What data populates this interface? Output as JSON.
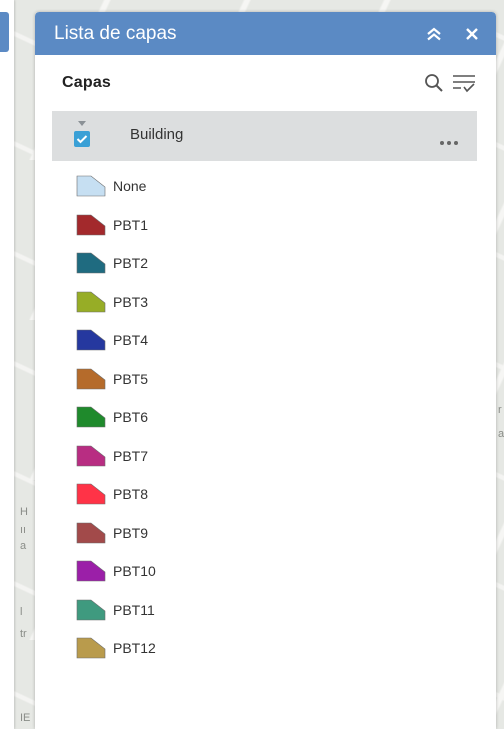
{
  "panel": {
    "title": "Lista de capas",
    "toolbar_title": "Capas"
  },
  "layer": {
    "name": "Building",
    "checked": true
  },
  "legend": [
    {
      "label": "None",
      "color": "#c6dff2"
    },
    {
      "label": "PBT1",
      "color": "#a3292c"
    },
    {
      "label": "PBT2",
      "color": "#1f6b80"
    },
    {
      "label": "PBT3",
      "color": "#97ad26"
    },
    {
      "label": "PBT4",
      "color": "#25389f"
    },
    {
      "label": "PBT5",
      "color": "#b56b2b"
    },
    {
      "label": "PBT6",
      "color": "#1f8a2c"
    },
    {
      "label": "PBT7",
      "color": "#b82d82"
    },
    {
      "label": "PBT8",
      "color": "#ff3347"
    },
    {
      "label": "PBT9",
      "color": "#a24a4a"
    },
    {
      "label": "PBT10",
      "color": "#9b1fa8"
    },
    {
      "label": "PBT11",
      "color": "#3f9a7f"
    },
    {
      "label": "PBT12",
      "color": "#b99b4c"
    }
  ],
  "colors": {
    "header": "#5b8ac4",
    "checkbox": "#3aa0d6",
    "layer_row_bg": "#dcdedf"
  }
}
